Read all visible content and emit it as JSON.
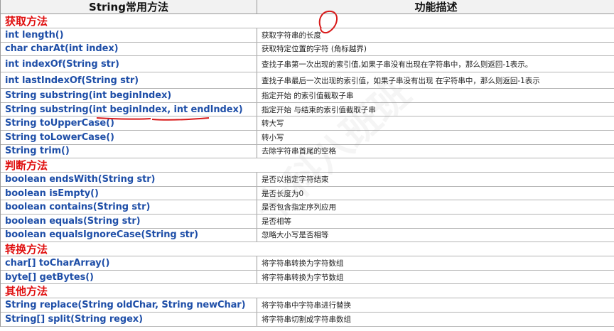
{
  "header": {
    "col_method": "String常用方法",
    "col_desc": "功能描述"
  },
  "sections": [
    {
      "title": "获取方法",
      "rows": [
        {
          "method": "int length()",
          "desc": "获取字符串的长度"
        },
        {
          "method": "char charAt(int index)",
          "desc": "获取特定位置的字符 (角标越界)"
        },
        {
          "method": "int indexOf(String str)",
          "desc": "查找子串第一次出现的索引值,如果子串没有出现在字符串中，那么则返回-1表示。"
        },
        {
          "method": "int lastIndexOf(String str)",
          "desc": "查找子串最后一次出现的索引值，如果子串没有出现 在字符串中，那么则返回-1表示"
        },
        {
          "method": "String substring(int beginIndex)",
          "desc": "指定开始 的索引值截取子串"
        },
        {
          "method": "String substring(int beginIndex, int endIndex)",
          "desc": "指定开始 与结束的索引值截取子串"
        },
        {
          "method": "String toUpperCase()",
          "desc": "转大写"
        },
        {
          "method": "String toLowerCase()",
          "desc": "转小写"
        },
        {
          "method": "String trim()",
          "desc": "去除字符串首尾的空格"
        }
      ]
    },
    {
      "title": "判断方法",
      "rows": [
        {
          "method": "boolean endsWith(String str)",
          "desc": "是否以指定字符结束"
        },
        {
          "method": "boolean isEmpty()",
          "desc": "是否长度为0"
        },
        {
          "method": "boolean contains(String str)",
          "desc": "是否包含指定序列应用"
        },
        {
          "method": "boolean equals(String str)",
          "desc": "是否相等"
        },
        {
          "method": "boolean equalsIgnoreCase(String str)",
          "desc": "忽略大小写是否相等"
        }
      ]
    },
    {
      "title": "转换方法",
      "rows": [
        {
          "method": "char[] toCharArray()",
          "desc": "将字符串转换为字符数组"
        },
        {
          "method": "byte[]  getBytes()",
          "desc": "将字符串转换为字节数组"
        }
      ]
    },
    {
      "title": "其他方法",
      "rows": [
        {
          "method": "String replace(String oldChar, String newChar)",
          "desc": "将字符串中字符串进行替换"
        },
        {
          "method": "String[] split(String regex)",
          "desc": "将字符串切割成字符串数组"
        }
      ]
    }
  ],
  "colors": {
    "method": "#1f4fa8",
    "section": "#e01010",
    "annotation": "#d81a1a"
  }
}
